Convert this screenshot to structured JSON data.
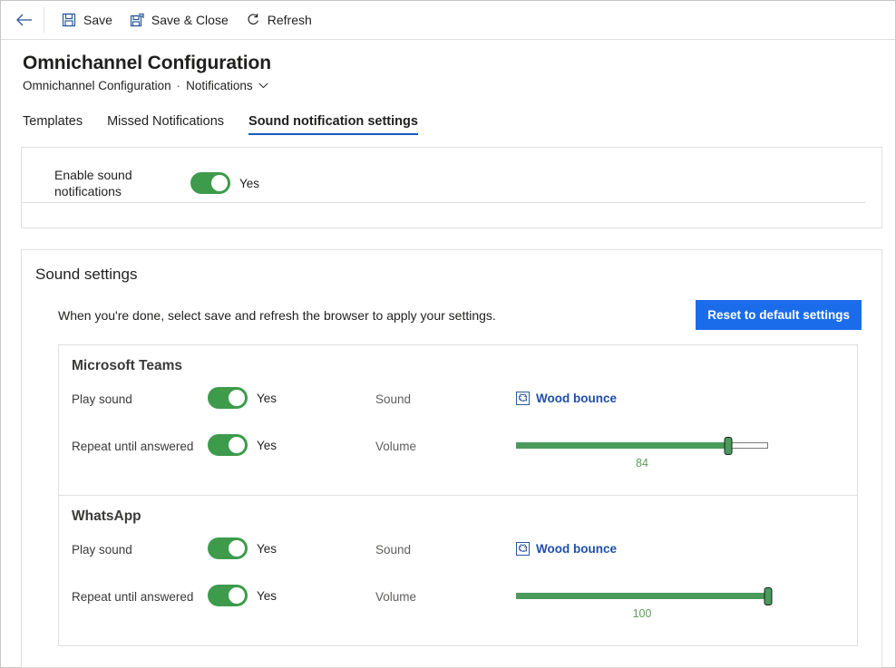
{
  "command_bar": {
    "back_label": "Back",
    "buttons": [
      {
        "id": "save",
        "label": "Save",
        "icon": "save-icon"
      },
      {
        "id": "save_close",
        "label": "Save & Close",
        "icon": "save-and-close-icon"
      },
      {
        "id": "refresh",
        "label": "Refresh",
        "icon": "refresh-icon"
      }
    ]
  },
  "header": {
    "title": "Omnichannel Configuration",
    "breadcrumb": {
      "parent": "Omnichannel Configuration",
      "separator": "·",
      "current": "Notifications"
    }
  },
  "tabs": [
    {
      "id": "templates",
      "label": "Templates",
      "active": false
    },
    {
      "id": "missed-notifications",
      "label": "Missed Notifications",
      "active": false
    },
    {
      "id": "sound-notification-settings",
      "label": "Sound notification settings",
      "active": true
    }
  ],
  "enable_section": {
    "label": "Enable sound notifications",
    "toggle": {
      "value": "Yes",
      "on": true
    }
  },
  "sound_settings": {
    "title": "Sound settings",
    "hint": "When you're done, select save and refresh the browser to apply your settings.",
    "reset_button": "Reset to default settings",
    "labels": {
      "play_sound": "Play sound",
      "repeat_until_answered": "Repeat until answered",
      "sound": "Sound",
      "volume": "Volume"
    },
    "channels": [
      {
        "id": "microsoft-teams",
        "name": "Microsoft Teams",
        "play_sound": {
          "value": "Yes",
          "on": true
        },
        "repeat_until_answered": {
          "value": "Yes",
          "on": true
        },
        "sound": {
          "name": "Wood bounce",
          "icon": "broken-image-icon"
        },
        "volume": {
          "value": 84,
          "display": "84",
          "min": 0,
          "max": 100
        }
      },
      {
        "id": "whatsapp",
        "name": "WhatsApp",
        "play_sound": {
          "value": "Yes",
          "on": true
        },
        "repeat_until_answered": {
          "value": "Yes",
          "on": true
        },
        "sound": {
          "name": "Wood bounce",
          "icon": "broken-image-icon"
        },
        "volume": {
          "value": 100,
          "display": "100",
          "min": 0,
          "max": 100
        }
      }
    ]
  },
  "colors": {
    "accent_blue": "#1b6ceb",
    "tab_underline": "#185abd",
    "toggle_on": "#3d9b4b",
    "slider_green": "#4a9a5c",
    "link_blue": "#1f4fa8",
    "border": "#e1dfdd"
  }
}
